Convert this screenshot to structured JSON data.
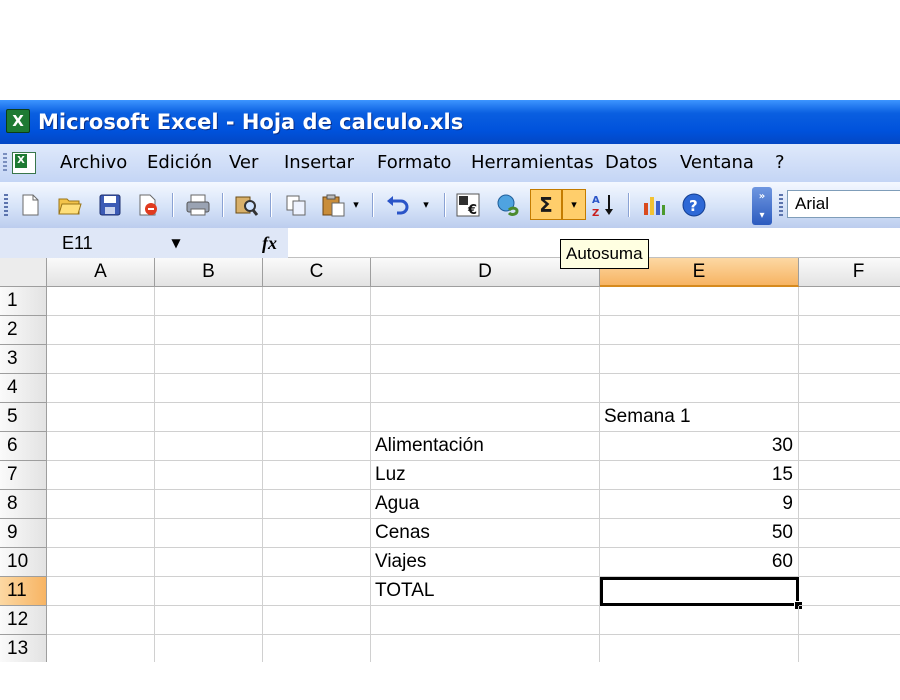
{
  "window": {
    "title": "Microsoft Excel - Hoja de calculo.xls"
  },
  "menu": [
    "Archivo",
    "Edición",
    "Ver",
    "Insertar",
    "Formato",
    "Herramientas",
    "Datos",
    "Ventana",
    "?"
  ],
  "toolbar": {
    "buttons": [
      "new-icon",
      "open-icon",
      "save-icon",
      "permission-icon",
      "print-icon",
      "research-icon",
      "copy-icon",
      "paste-icon",
      "undo-icon",
      "euro-icon",
      "hyperlink-icon",
      "autosum-icon",
      "sort-ascending-icon",
      "chart-wizard-icon",
      "help-icon"
    ],
    "autosum_symbol": "Σ",
    "font_name": "Arial",
    "accent_color": "#ffce6b"
  },
  "formula_bar": {
    "name_box": "E11",
    "fx_label": "fx",
    "content": ""
  },
  "tooltip": "Autosuma",
  "columns": [
    "A",
    "B",
    "C",
    "D",
    "E",
    "F"
  ],
  "active_column": "E",
  "rows": [
    "1",
    "2",
    "3",
    "4",
    "5",
    "6",
    "7",
    "8",
    "9",
    "10",
    "11",
    "12",
    "13"
  ],
  "active_row": "11",
  "cells": {
    "E5": "Semana 1",
    "D6": "Alimentación",
    "E6": "30",
    "D7": "Luz",
    "E7": "15",
    "D8": "Agua",
    "E8": "9",
    "D9": "Cenas",
    "E9": "50",
    "D10": "Viajes",
    "E10": "60",
    "D11": "TOTAL",
    "E11": ""
  },
  "colors": {
    "titlebar": "#0052dc",
    "selection_header": "#f7b463"
  }
}
